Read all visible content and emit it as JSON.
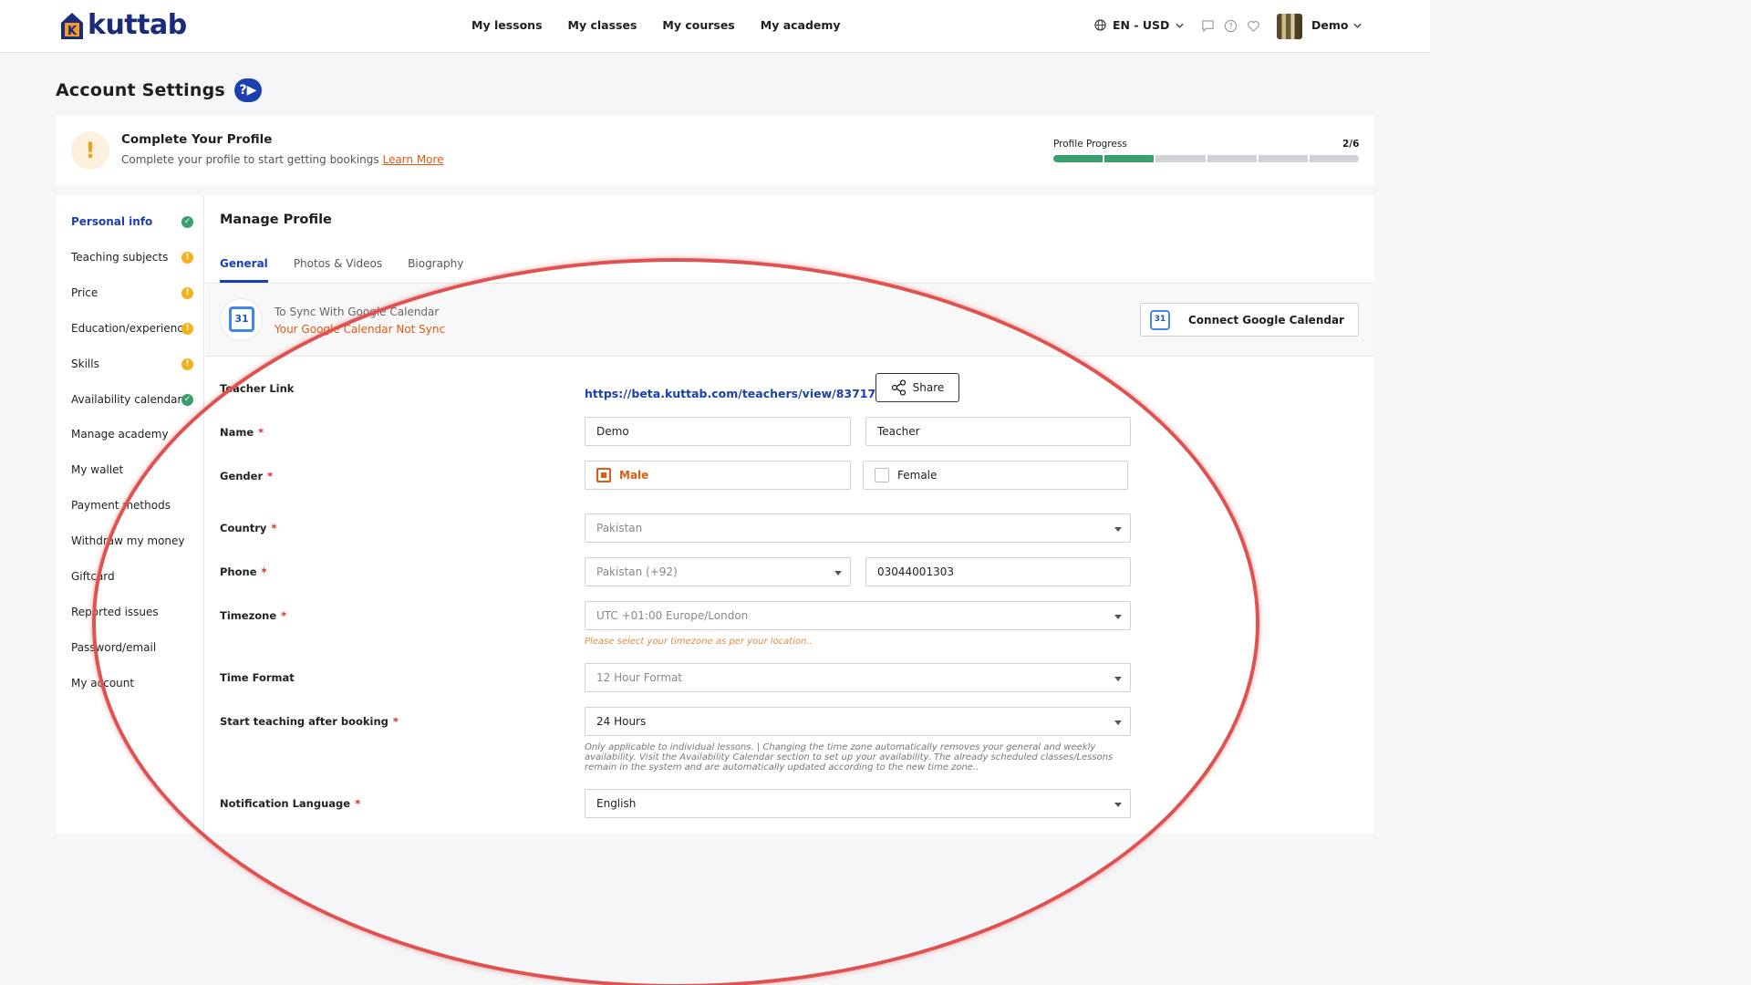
{
  "header": {
    "logo_text": "kuttab",
    "logo_mark_letter": "K",
    "nav": [
      "My lessons",
      "My classes",
      "My courses",
      "My academy"
    ],
    "locale": "EN - USD",
    "user": "Demo"
  },
  "page": {
    "title": "Account Settings",
    "help_badge": "?▶"
  },
  "profile_card": {
    "title": "Complete Your Profile",
    "subtitle": "Complete your profile to start getting bookings",
    "learn_more": "Learn More",
    "progress_label": "Profile Progress",
    "progress_count": "2/6",
    "progress_completed": 2,
    "progress_total": 6
  },
  "sidebar": {
    "items": [
      {
        "label": "Personal info",
        "status": "ok"
      },
      {
        "label": "Teaching subjects",
        "status": "warn"
      },
      {
        "label": "Price",
        "status": "warn"
      },
      {
        "label": "Education/experience",
        "status": "warn"
      },
      {
        "label": "Skills",
        "status": "warn"
      },
      {
        "label": "Availability calendar",
        "status": "ok"
      },
      {
        "label": "Manage academy",
        "status": ""
      },
      {
        "label": "My wallet",
        "status": ""
      },
      {
        "label": "Payment methods",
        "status": ""
      },
      {
        "label": "Withdraw my money",
        "status": ""
      },
      {
        "label": "Giftcard",
        "status": ""
      },
      {
        "label": "Reported issues",
        "status": ""
      },
      {
        "label": "Password/email",
        "status": ""
      },
      {
        "label": "My account",
        "status": ""
      }
    ]
  },
  "main": {
    "title": "Manage Profile",
    "tabs": [
      "General",
      "Photos & Videos",
      "Biography"
    ],
    "gcal": {
      "line1": "To Sync With Google Calendar",
      "line2": "Your Google Calendar Not Sync",
      "button": "Connect Google Calendar",
      "icon_day": "31"
    },
    "form": {
      "teacher_link_label": "Teacher Link",
      "teacher_link": "https://beta.kuttab.com/teachers/view/83717092",
      "share": "Share",
      "name_label": "Name",
      "first_name": "Demo",
      "last_name": "Teacher",
      "gender_label": "Gender",
      "gender_male": "Male",
      "gender_female": "Female",
      "country_label": "Country",
      "country": "Pakistan",
      "phone_label": "Phone",
      "phone_code": "Pakistan (+92)",
      "phone_number": "03044001303",
      "timezone_label": "Timezone",
      "timezone": "UTC +01:00 Europe/London",
      "timezone_hint": "Please select your timezone as per your location..",
      "time_format_label": "Time Format",
      "time_format": "12 Hour Format",
      "start_teaching_label": "Start teaching after booking",
      "start_teaching": "24 Hours",
      "note": "Only applicable to individual lessons. | Changing the time zone automatically removes your general and weekly availability. Visit the Availability Calendar section to set up your availability. The already scheduled classes/Lessons remain in the system and are automatically updated according to the new time zone..",
      "notification_label": "Notification Language",
      "notification_language": "English",
      "required_mark": "*"
    }
  },
  "colors": {
    "brand_blue": "#1a3fae",
    "accent_orange": "#e05a12",
    "success_green": "#3b9e6f",
    "warn_yellow": "#f2b21a",
    "annotation_red": "#e05252"
  }
}
